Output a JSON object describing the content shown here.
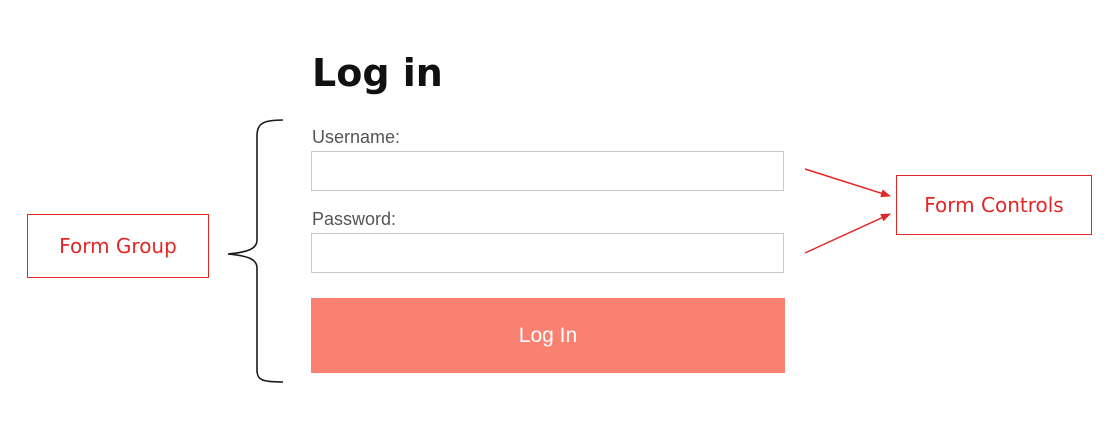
{
  "login_form": {
    "title": "Log in",
    "username_label": "Username:",
    "username_value": "",
    "password_label": "Password:",
    "password_value": "",
    "submit_label": "Log In",
    "submit_color": "#fa8072"
  },
  "annotations": {
    "form_group_label": "Form Group",
    "form_controls_label": "Form Controls",
    "color": "#e32626"
  }
}
